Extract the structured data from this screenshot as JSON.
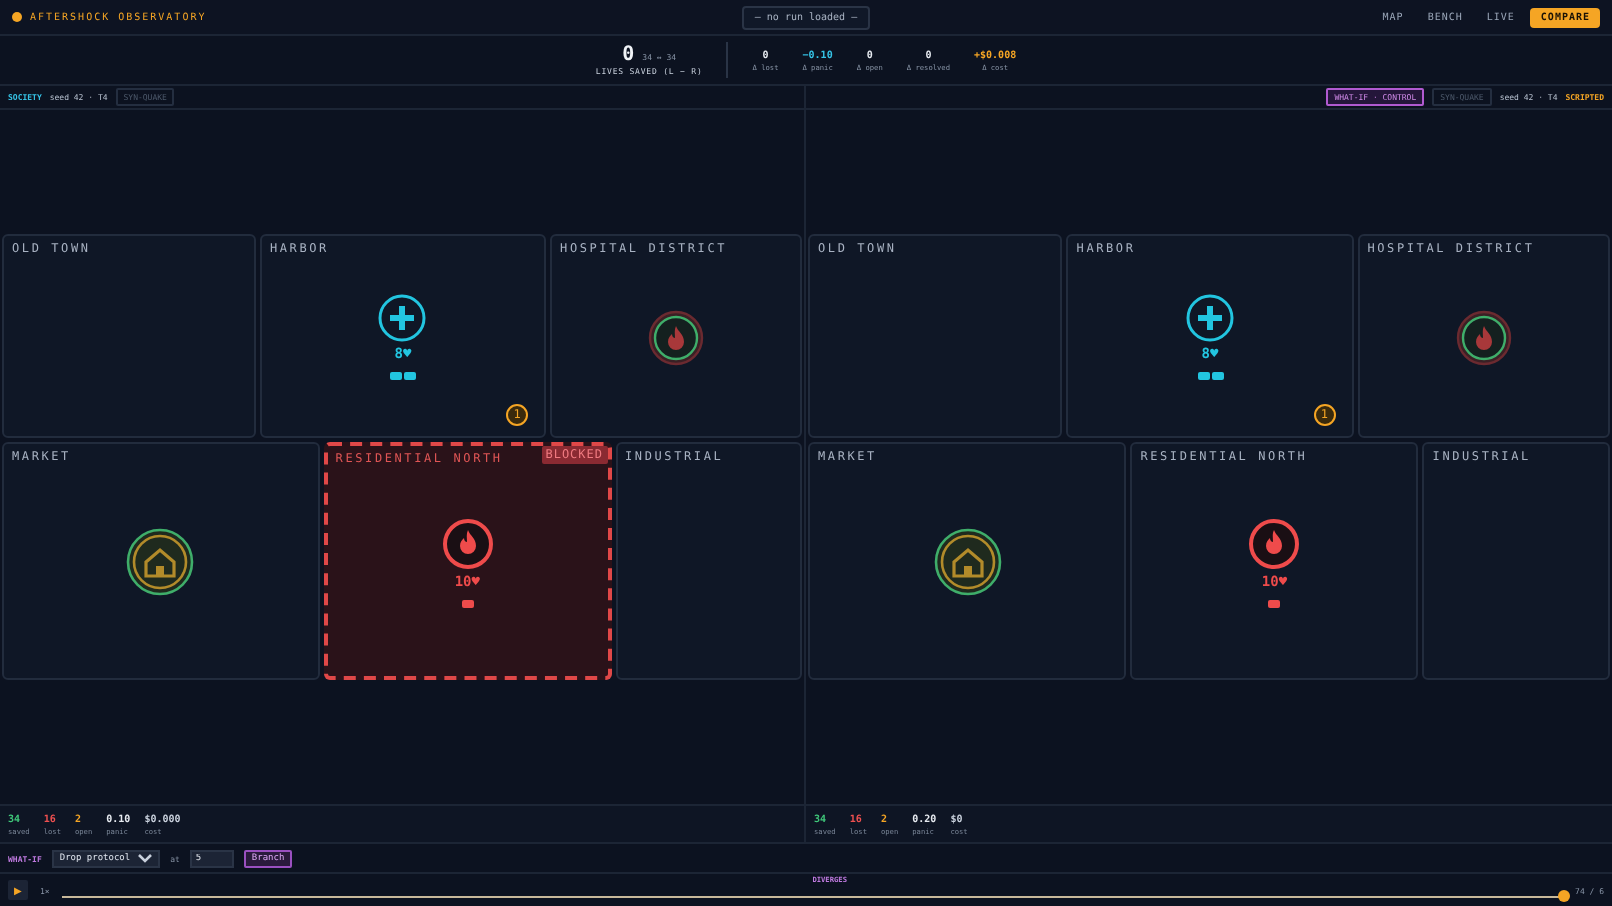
{
  "header": {
    "brand": "AFTERSHOCK OBSERVATORY",
    "run_select": "— no run loaded —",
    "nav": [
      {
        "label": "MAP",
        "selected": false
      },
      {
        "label": "BENCH",
        "selected": false
      },
      {
        "label": "LIVE",
        "selected": false
      },
      {
        "label": "COMPARE",
        "selected": true
      }
    ]
  },
  "summary": {
    "value": "0",
    "pair": "34 ↔ 34",
    "label": "LIVES SAVED (L − R)",
    "deltas": [
      {
        "value": "0",
        "label": "Δ lost",
        "color": "#e6eaf0"
      },
      {
        "value": "−0.10",
        "label": "Δ panic",
        "color": "#35c3e6"
      },
      {
        "value": "0",
        "label": "Δ open",
        "color": "#e6eaf0"
      },
      {
        "value": "0",
        "label": "Δ resolved",
        "color": "#e6eaf0"
      },
      {
        "value": "+$0.008",
        "label": "Δ cost",
        "color": "#f5a524"
      }
    ]
  },
  "panes": [
    {
      "tag": "SOCIETY",
      "kind": "society",
      "seed": "seed 42 · T4",
      "scenario": "SYN-QUAKE",
      "districts": [
        {
          "name": "OLD TOWN",
          "selected": false
        },
        {
          "name": "HARBOR",
          "selected": false,
          "incident": {
            "kind": "medical",
            "count": "8♥",
            "units": [
              {
                "kind": "unit"
              },
              {
                "kind": "unit"
              }
            ],
            "badge": "1"
          }
        },
        {
          "name": "HOSPITAL DISTRICT",
          "selected": false,
          "incident": {
            "kind": "fire_contained"
          }
        },
        {
          "name": "MARKET",
          "selected": false,
          "incident": {
            "kind": "shelter"
          }
        },
        {
          "name": "RESIDENTIAL NORTH",
          "selected": true,
          "blocked": "BLOCKED",
          "incident": {
            "kind": "fire",
            "count": "10♥",
            "units": [
              {
                "kind": "unit"
              }
            ]
          }
        },
        {
          "name": "INDUSTRIAL",
          "selected": false
        }
      ],
      "stats": [
        {
          "value": "34",
          "label": "saved",
          "color": "#3fc87a"
        },
        {
          "value": "16",
          "label": "lost",
          "color": "#ef5050"
        },
        {
          "value": "2",
          "label": "open",
          "color": "#f5a524"
        },
        {
          "value": "0.10",
          "label": "panic",
          "color": "#e6eaf0"
        },
        {
          "value": "$0.000",
          "label": "cost",
          "color": "#c8d0dc"
        }
      ]
    },
    {
      "tag": "WHAT-IF · CONTROL",
      "kind": "whatif",
      "seed": "seed 42 · T4",
      "scenario": "SYN-QUAKE",
      "mode": "SCRIPTED",
      "districts": [
        {
          "name": "OLD TOWN",
          "selected": false
        },
        {
          "name": "HARBOR",
          "selected": false,
          "incident": {
            "kind": "medical",
            "count": "8♥",
            "units": [
              {
                "kind": "unit"
              },
              {
                "kind": "unit"
              }
            ],
            "badge": "1"
          }
        },
        {
          "name": "HOSPITAL DISTRICT",
          "selected": false,
          "incident": {
            "kind": "fire_contained"
          }
        },
        {
          "name": "MARKET",
          "selected": false,
          "incident": {
            "kind": "shelter"
          }
        },
        {
          "name": "RESIDENTIAL NORTH",
          "selected": false,
          "incident": {
            "kind": "fire",
            "count": "10♥",
            "units": [
              {
                "kind": "unit"
              }
            ]
          }
        },
        {
          "name": "INDUSTRIAL",
          "selected": false
        }
      ],
      "stats": [
        {
          "value": "34",
          "label": "saved",
          "color": "#3fc87a"
        },
        {
          "value": "16",
          "label": "lost",
          "color": "#ef5050"
        },
        {
          "value": "2",
          "label": "open",
          "color": "#f5a524"
        },
        {
          "value": "0.20",
          "label": "panic",
          "color": "#e6eaf0"
        },
        {
          "value": "$0",
          "label": "cost",
          "color": "#c8d0dc"
        }
      ]
    }
  ],
  "whatif": {
    "label": "WHAT-IF",
    "protocol": "Drop protocol",
    "at": "at",
    "turn": "5",
    "button": "Branch"
  },
  "timeline": {
    "play": "▶",
    "speed": "1×",
    "marker": "DIVERGES",
    "level": 1,
    "position": "74 / 6"
  }
}
